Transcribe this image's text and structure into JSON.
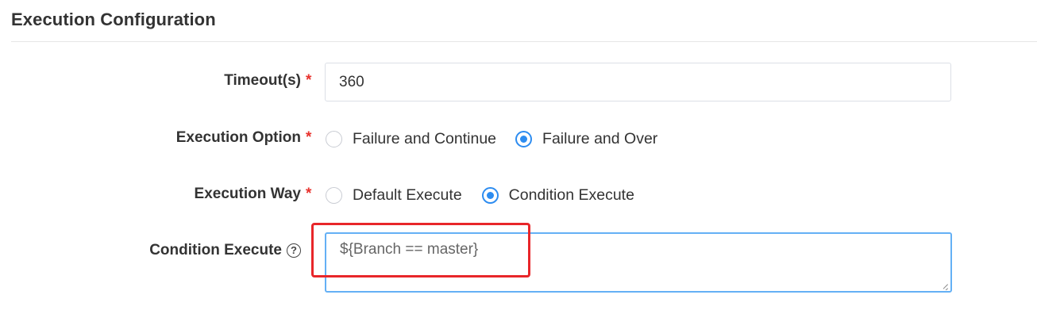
{
  "section": {
    "title": "Execution Configuration"
  },
  "fields": {
    "timeout": {
      "label": "Timeout(s)",
      "required_mark": "*",
      "value": "360"
    },
    "execution_option": {
      "label": "Execution Option",
      "required_mark": "*",
      "options": [
        "Failure and Continue",
        "Failure and Over"
      ],
      "selected": "Failure and Over"
    },
    "execution_way": {
      "label": "Execution Way",
      "required_mark": "*",
      "options": [
        "Default Execute",
        "Condition Execute"
      ],
      "selected": "Condition Execute"
    },
    "condition_execute": {
      "label": "Condition Execute",
      "help_icon": "?",
      "value": "${Branch == master}"
    }
  },
  "colors": {
    "accent": "#2d8cf0",
    "required": "#e8322d",
    "highlight": "#e8262a",
    "focus_border": "#64b0f5"
  },
  "icons": {
    "help": "question-circle-icon",
    "resize": "resize-grip-icon"
  }
}
